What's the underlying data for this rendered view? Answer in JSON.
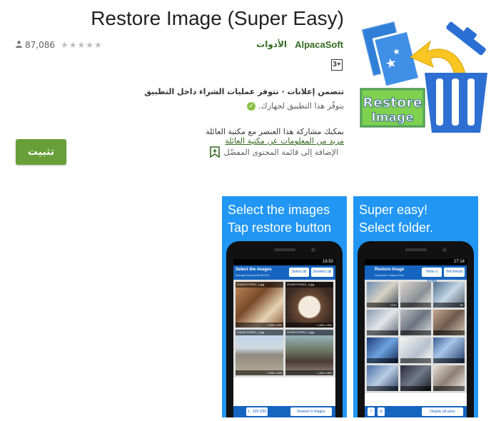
{
  "app": {
    "title": "Restore Image (Super Easy)",
    "review_count": "87,086",
    "stars": "★★★★★",
    "developer": "AlpacaSoft",
    "category": "الأدوات",
    "content_rating": "3+",
    "ads_notice": "تتضمن إعلانات · تتوفر عمليات الشراء داخل التطبيق",
    "availability": "يتوفّر هذا التطبيق لجهازك.",
    "family_text": "بمكنك مشاركة هذا العنصر مع مكتبة العائلة",
    "family_link": "مزيد من المعلومات عن مكتبة العائلة",
    "install_label": "تثبيت",
    "wishlist_label": "الإضافة إلى قائمة المحتوى المفضّل"
  },
  "app_icon": {
    "label_line1": "Restore",
    "label_line2": "Image"
  },
  "screenshots": [
    {
      "caption_line1": "Select the images",
      "caption_line2": "Tap restore button",
      "status_time": "16:50",
      "app_bar_title": "Select the images",
      "app_bar_sub": "/storage/emulated/0/DCIM",
      "btn_left": "Select all",
      "btn_right": "Deselect all",
      "cells": [
        {
          "label": "20160727/DSC_1.jpg",
          "size": "L 800 x 600"
        },
        {
          "label": "20160727/DSC_2.jpg",
          "size": "L 800 x 600"
        },
        {
          "label": "20160727/DSC_3.jpg",
          "size": "L 800 x 600"
        },
        {
          "label": "20160727/DSC_4.jpg",
          "size": "L 800 x 600"
        }
      ],
      "bottom_left": "1 - 100 /250",
      "bottom_right": "Restore 0 images"
    },
    {
      "caption_line1": "Super easy!",
      "caption_line2": "Select folder.",
      "status_time": "17:14",
      "app_bar_title": "Restore Image",
      "app_bar_sub": "Developer: Alpaca Soft",
      "btn_left": "Write a review",
      "btn_right": "Tell friends",
      "counts": [
        "1213",
        "59",
        "",
        "",
        "",
        "",
        "",
        "",
        ""
      ],
      "bottom_right": "Display all sizes"
    }
  ],
  "colors": {
    "accent_green": "#689f38",
    "dev_green": "#33691e",
    "screenshot_blue": "#2196f3",
    "appbar_blue": "#1565c0"
  }
}
